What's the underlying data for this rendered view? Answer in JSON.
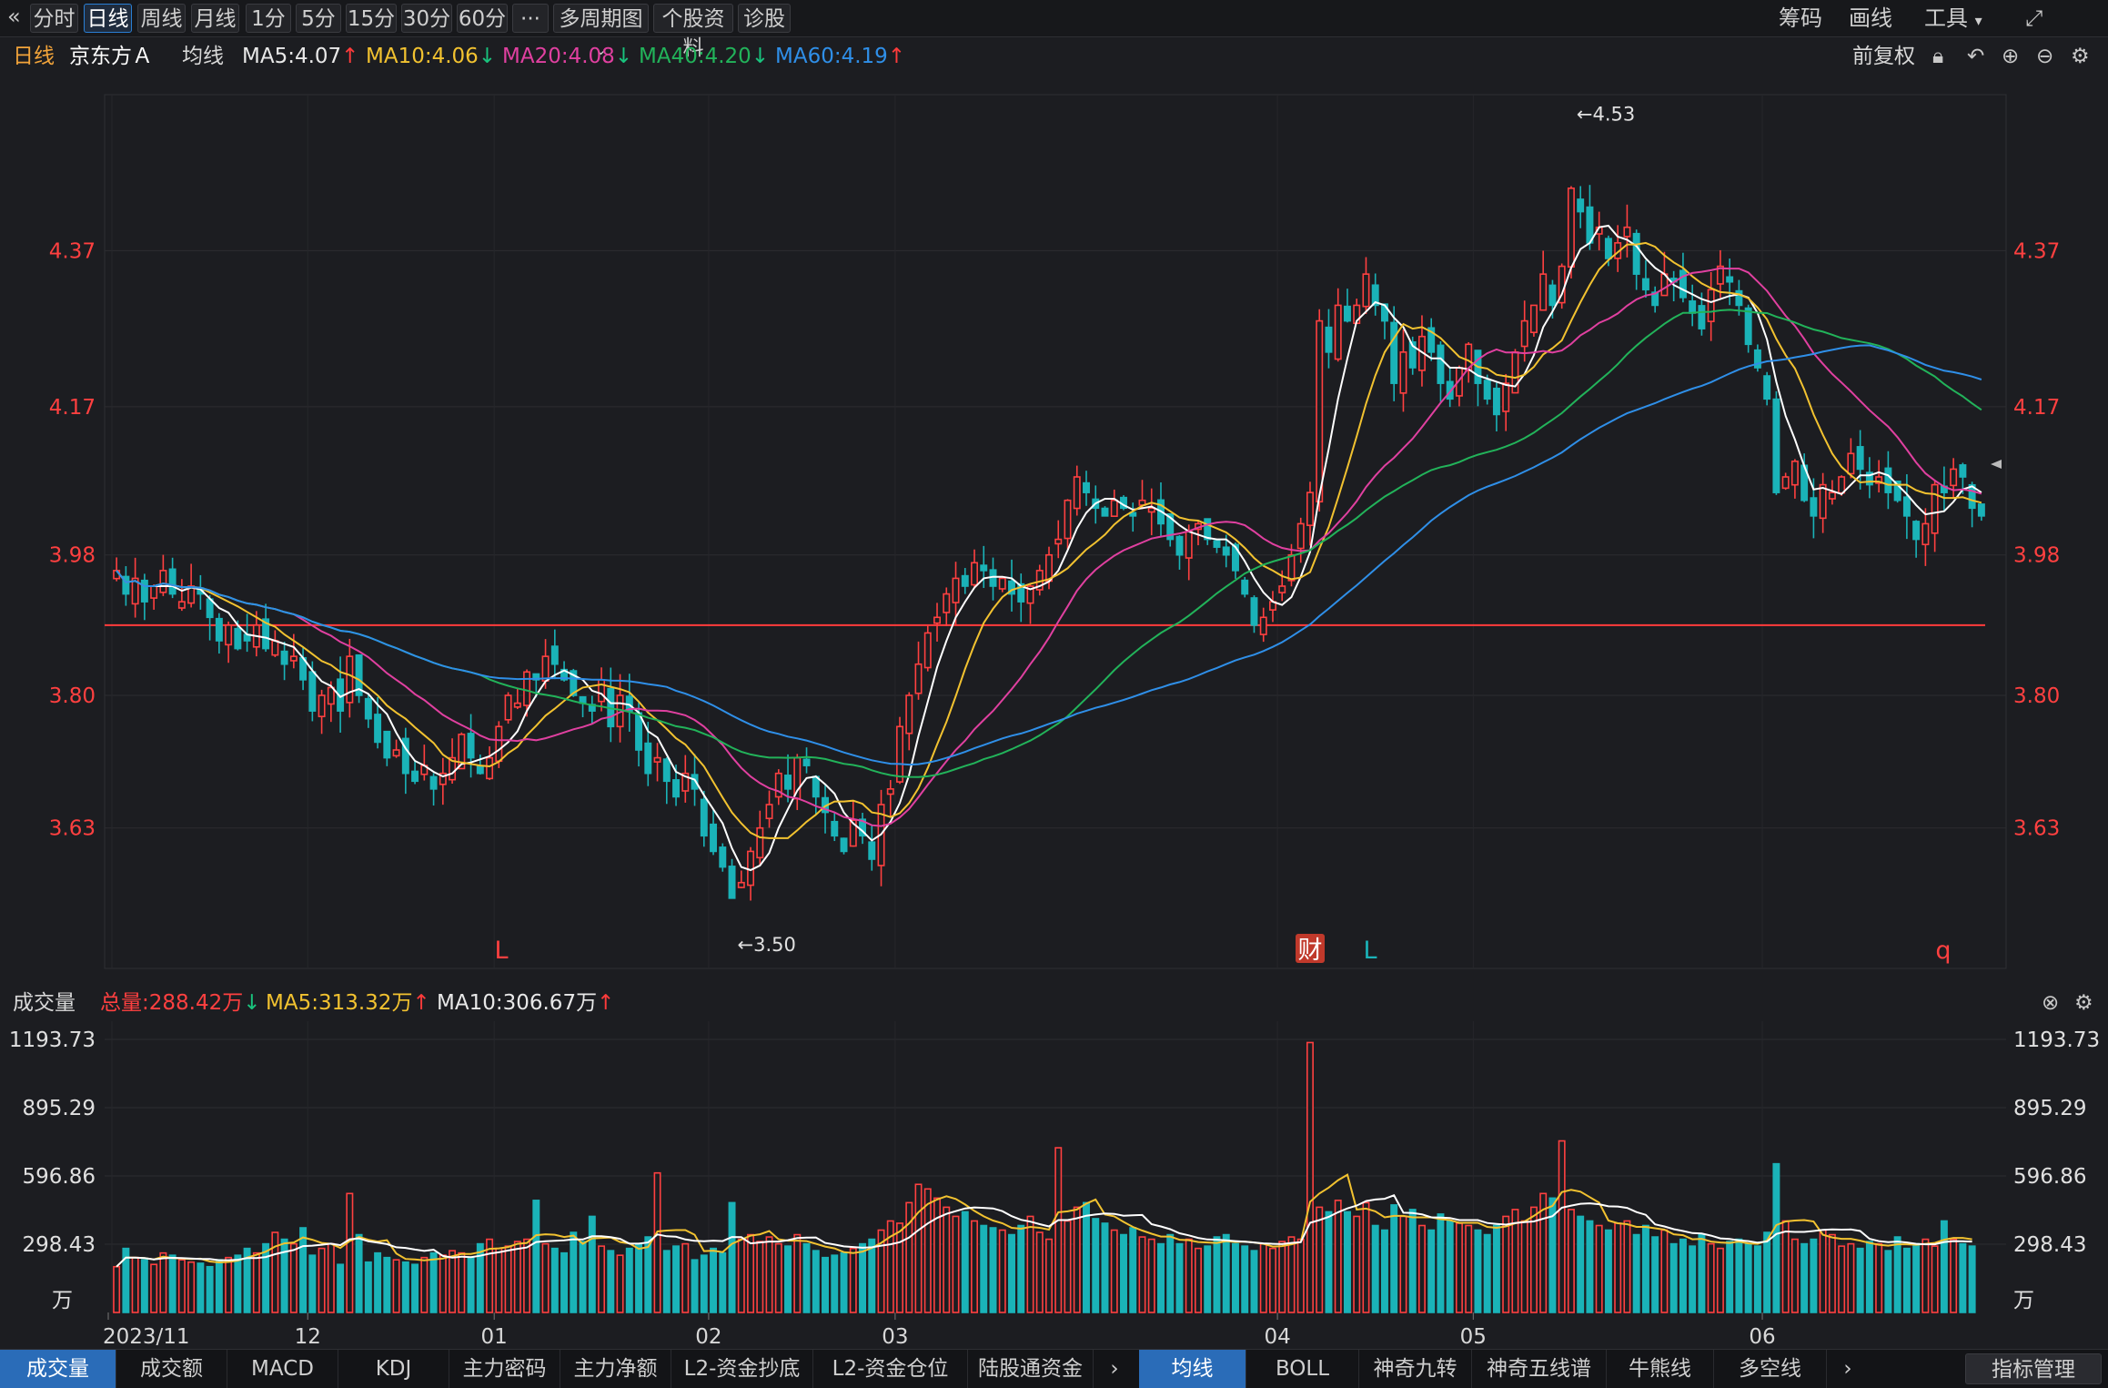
{
  "toolbar": {
    "back_icon": "double-chevron-left-icon",
    "tabs": [
      "分时",
      "日线",
      "周线",
      "月线",
      "1分",
      "5分",
      "15分",
      "30分",
      "60分",
      "···",
      "多周期图",
      "个股资料",
      "诊股"
    ],
    "active_tab": "日线",
    "right": {
      "chip": "筹码",
      "draw": "画线",
      "tools": "工具",
      "expand_icon": "expand-icon"
    }
  },
  "legend": {
    "period": "日线",
    "stock_name": "京东方Ａ",
    "ma_label": "均线",
    "ma": [
      {
        "text": "MA5:4.07",
        "color": "#e8e8e8",
        "arrow": "↑",
        "arrow_color": "#ff3b3b"
      },
      {
        "text": "MA10:4.06",
        "color": "#f2c230",
        "arrow": "↓",
        "arrow_color": "#19c37d"
      },
      {
        "text": "MA20:4.08",
        "color": "#e040a0",
        "arrow": "↓",
        "arrow_color": "#19c37d"
      },
      {
        "text": "MA40:4.20",
        "color": "#22b35a",
        "arrow": "↓",
        "arrow_color": "#19c37d"
      },
      {
        "text": "MA60:4.19",
        "color": "#2f8fe8",
        "arrow": "↑",
        "arrow_color": "#ff3b3b"
      }
    ],
    "adjust": "前复权"
  },
  "volume_legend": {
    "title": "成交量",
    "total": "总量:288.42万",
    "total_arrow": "↓",
    "ma5": "MA5:313.32万",
    "ma5_arrow": "↑",
    "ma10": "MA10:306.67万",
    "ma10_arrow": "↑"
  },
  "bottom_tabs_left": [
    "成交量",
    "成交额",
    "MACD",
    "KDJ",
    "主力密码",
    "主力净额",
    "L2-资金抄底",
    "L2-资金仓位",
    "陆股通资金"
  ],
  "bottom_tabs_right": [
    "均线",
    "BOLL",
    "神奇九转",
    "神奇五线谱",
    "牛熊线",
    "多空线"
  ],
  "indicator_manage": "指标管理",
  "colors": {
    "up": "#ff4040",
    "down": "#1ab3b8",
    "ma5": "#ffffff",
    "ma10": "#f2c230",
    "ma20": "#e040a0",
    "ma40": "#22b35a",
    "ma60": "#2f8fe8",
    "hline": "#ff3b3b"
  },
  "chart_data": [
    {
      "type": "candlestick",
      "title": "京东方Ａ 日线 (前复权)",
      "x_labels": [
        "2023/11",
        "12",
        "01",
        "02",
        "03",
        "04",
        "05",
        "06"
      ],
      "y_ticks": [
        "4.37",
        "4.17",
        "3.98",
        "3.80",
        "3.63"
      ],
      "ylim": [
        3.45,
        4.57
      ],
      "max_label": "4.53",
      "min_label": "3.50",
      "horizontal_line": 3.89,
      "markers": [
        {
          "text": "L",
          "color": "#ff4040",
          "at": "2023-12"
        },
        {
          "text": "财",
          "color": "#ffffff",
          "at": "2024-04"
        },
        {
          "text": "L",
          "color": "#1ab3b8",
          "at": "2024-04"
        },
        {
          "text": "q",
          "color": "#ff4040",
          "at": "2024-06"
        }
      ],
      "closes": [
        3.96,
        3.93,
        3.95,
        3.92,
        3.94,
        3.96,
        3.93,
        3.92,
        3.94,
        3.93,
        3.9,
        3.87,
        3.89,
        3.86,
        3.87,
        3.89,
        3.86,
        3.87,
        3.84,
        3.85,
        3.82,
        3.78,
        3.8,
        3.81,
        3.78,
        3.85,
        3.8,
        3.77,
        3.74,
        3.72,
        3.73,
        3.7,
        3.69,
        3.71,
        3.68,
        3.7,
        3.72,
        3.75,
        3.72,
        3.7,
        3.72,
        3.76,
        3.8,
        3.79,
        3.83,
        3.82,
        3.85,
        3.84,
        3.82,
        3.8,
        3.79,
        3.78,
        3.82,
        3.76,
        3.8,
        3.78,
        3.73,
        3.7,
        3.72,
        3.69,
        3.67,
        3.7,
        3.68,
        3.62,
        3.6,
        3.58,
        3.54,
        3.56,
        3.6,
        3.63,
        3.66,
        3.7,
        3.68,
        3.72,
        3.71,
        3.67,
        3.65,
        3.62,
        3.6,
        3.64,
        3.62,
        3.59,
        3.66,
        3.68,
        3.76,
        3.8,
        3.84,
        3.88,
        3.9,
        3.93,
        3.95,
        3.94,
        3.97,
        3.96,
        3.94,
        3.95,
        3.93,
        3.92,
        3.94,
        3.96,
        3.98,
        4.0,
        4.05,
        4.08,
        4.06,
        4.04,
        4.03,
        4.05,
        4.04,
        4.03,
        4.05,
        4.04,
        4.02,
        4.0,
        3.98,
        4.01,
        4.02,
        4.0,
        3.99,
        3.98,
        3.96,
        3.93,
        3.89,
        3.9,
        3.92,
        3.94,
        3.98,
        4.02,
        4.06,
        4.28,
        4.24,
        4.3,
        4.28,
        4.3,
        4.34,
        4.3,
        4.28,
        4.2,
        4.24,
        4.22,
        4.26,
        4.24,
        4.2,
        4.18,
        4.22,
        4.25,
        4.2,
        4.18,
        4.16,
        4.2,
        4.24,
        4.28,
        4.3,
        4.34,
        4.3,
        4.35,
        4.45,
        4.42,
        4.38,
        4.4,
        4.36,
        4.38,
        4.4,
        4.34,
        4.32,
        4.3,
        4.34,
        4.33,
        4.31,
        4.29,
        4.27,
        4.32,
        4.35,
        4.33,
        4.3,
        4.25,
        4.22,
        4.18,
        4.06,
        4.08,
        4.1,
        4.05,
        4.03,
        4.07,
        4.06,
        4.08,
        4.11,
        4.09,
        4.07,
        4.08,
        4.06,
        4.05,
        4.03,
        4.0,
        4.02,
        4.07,
        4.06,
        4.09,
        4.08,
        4.04,
        4.03
      ]
    },
    {
      "type": "bar",
      "title": "成交量",
      "unit": "万",
      "y_ticks": [
        "1193.73",
        "895.29",
        "596.86",
        "298.43"
      ],
      "ylim": [
        0,
        1193.73
      ],
      "values": [
        200,
        280,
        240,
        230,
        210,
        260,
        250,
        230,
        220,
        215,
        200,
        230,
        240,
        250,
        280,
        260,
        300,
        350,
        320,
        300,
        370,
        250,
        280,
        300,
        210,
        520,
        340,
        220,
        260,
        240,
        230,
        220,
        210,
        240,
        260,
        250,
        270,
        260,
        240,
        300,
        320,
        280,
        290,
        310,
        320,
        490,
        300,
        280,
        260,
        350,
        310,
        420,
        290,
        270,
        250,
        280,
        300,
        330,
        610,
        270,
        290,
        300,
        230,
        250,
        280,
        260,
        480,
        320,
        340,
        310,
        330,
        300,
        290,
        340,
        300,
        270,
        240,
        250,
        260,
        280,
        300,
        320,
        360,
        400,
        390,
        480,
        560,
        540,
        500,
        460,
        420,
        440,
        400,
        380,
        370,
        360,
        340,
        380,
        420,
        350,
        320,
        720,
        400,
        460,
        480,
        410,
        390,
        360,
        340,
        370,
        330,
        320,
        300,
        340,
        300,
        320,
        280,
        290,
        330,
        340,
        300,
        290,
        270,
        300,
        280,
        310,
        330,
        320,
        1180,
        460,
        440,
        490,
        440,
        420,
        480,
        380,
        360,
        470,
        420,
        450,
        380,
        360,
        430,
        400,
        390,
        380,
        360,
        340,
        380,
        420,
        450,
        400,
        460,
        520,
        500,
        750,
        450,
        420,
        400,
        380,
        360,
        390,
        400,
        340,
        380,
        330,
        360,
        300,
        320,
        290,
        340,
        300,
        280,
        310,
        320,
        300,
        290,
        350,
        650,
        400,
        320,
        300,
        320,
        360,
        340,
        290,
        300,
        280,
        310,
        300,
        270,
        330,
        280,
        300,
        320,
        290,
        400,
        320,
        300,
        290
      ]
    }
  ]
}
